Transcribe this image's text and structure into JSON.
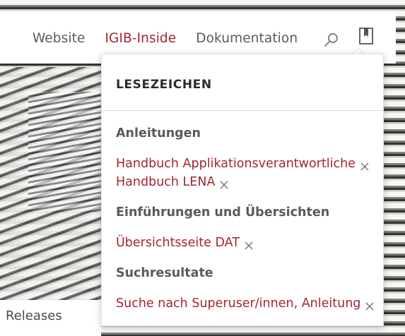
{
  "nav": {
    "items": [
      {
        "label": "Website",
        "active": false
      },
      {
        "label": "IGIB-Inside",
        "active": true
      },
      {
        "label": "Dokumentation",
        "active": false
      }
    ],
    "search_icon": "search-icon",
    "bookmark_icon": "bookmark-icon"
  },
  "bookmarks_panel": {
    "title": "LESEZEICHEN",
    "groups": [
      {
        "title": "Anleitungen",
        "items": [
          {
            "label": "Handbuch Applikationsverantwortliche"
          },
          {
            "label": "Handbuch LENA"
          }
        ]
      },
      {
        "title": "Einführungen und Übersichten",
        "items": [
          {
            "label": "Übersichtsseite DAT"
          }
        ]
      },
      {
        "title": "Suchresultate",
        "items": [
          {
            "label": "Suche nach Superuser/innen, Anleitung"
          }
        ]
      }
    ],
    "remove_icon": "close-icon"
  },
  "page": {
    "releases_label": "Releases"
  },
  "colors": {
    "accent": "#a3252f",
    "nav_text": "#5a5a5a",
    "heading_text": "#2c2c2c"
  }
}
